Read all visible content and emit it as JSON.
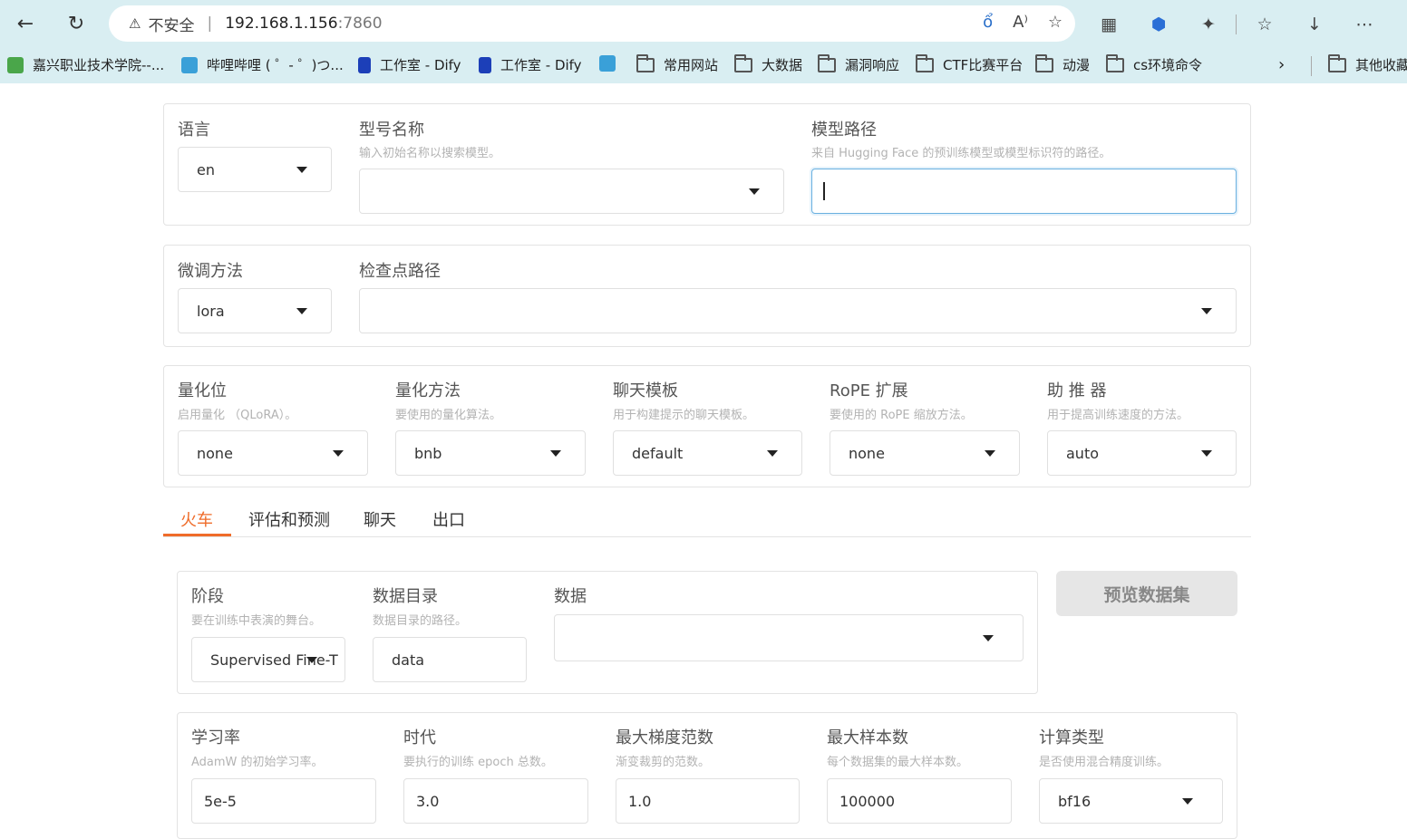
{
  "browser": {
    "security_label": "不安全",
    "host": "192.168.1.156",
    "port": ":7860",
    "bookmarks": [
      {
        "label": "嘉兴职业技术学院--..."
      },
      {
        "label": "哔哩哔哩 ( ゜- ゜)つ..."
      },
      {
        "label": "工作室 - Dify"
      },
      {
        "label": "工作室 - Dify"
      },
      {
        "label": ""
      },
      {
        "label": "常用网站"
      },
      {
        "label": "大数据"
      },
      {
        "label": "漏洞响应"
      },
      {
        "label": "CTF比赛平台"
      },
      {
        "label": "动漫"
      },
      {
        "label": "cs环境命令"
      },
      {
        "label": "其他收藏"
      }
    ]
  },
  "model": {
    "lang_label": "语言",
    "lang_value": "en",
    "name_label": "型号名称",
    "name_hint": "输入初始名称以搜索模型。",
    "name_value": "",
    "path_label": "模型路径",
    "path_hint": "来自 Hugging Face 的预训练模型或模型标识符的路径。",
    "path_value": ""
  },
  "finetune": {
    "method_label": "微调方法",
    "method_value": "lora",
    "ckpt_label": "检查点路径",
    "ckpt_value": ""
  },
  "advanced": {
    "quant_bit_label": "量化位",
    "quant_bit_hint": "启用量化 （QLoRA）。",
    "quant_bit_value": "none",
    "quant_method_label": "量化方法",
    "quant_method_hint": "要使用的量化算法。",
    "quant_method_value": "bnb",
    "template_label": "聊天模板",
    "template_hint": "用于构建提示的聊天模板。",
    "template_value": "default",
    "rope_label": "RoPE 扩展",
    "rope_hint": "要使用的 RoPE 缩放方法。",
    "rope_value": "none",
    "booster_label": "助 推 器",
    "booster_hint": "用于提高训练速度的方法。",
    "booster_value": "auto"
  },
  "tabs": [
    "火车",
    "评估和预测",
    "聊天",
    "出口"
  ],
  "train": {
    "stage_label": "阶段",
    "stage_hint": "要在训练中表演的舞台。",
    "stage_value": "Supervised Fine-T",
    "dataset_dir_label": "数据目录",
    "dataset_dir_hint": "数据目录的路径。",
    "dataset_dir_value": "data",
    "dataset_label": "数据",
    "dataset_value": "",
    "preview_button": "预览数据集",
    "lr_label": "学习率",
    "lr_hint": "AdamW 的初始学习率。",
    "lr_value": "5e-5",
    "epochs_label": "时代",
    "epochs_hint": "要执行的训练 epoch 总数。",
    "epochs_value": "3.0",
    "grad_label": "最大梯度范数",
    "grad_hint": "渐变裁剪的范数。",
    "grad_value": "1.0",
    "samples_label": "最大样本数",
    "samples_hint": "每个数据集的最大样本数。",
    "samples_value": "100000",
    "compute_label": "计算类型",
    "compute_hint": "是否使用混合精度训练。",
    "compute_value": "bf16"
  }
}
